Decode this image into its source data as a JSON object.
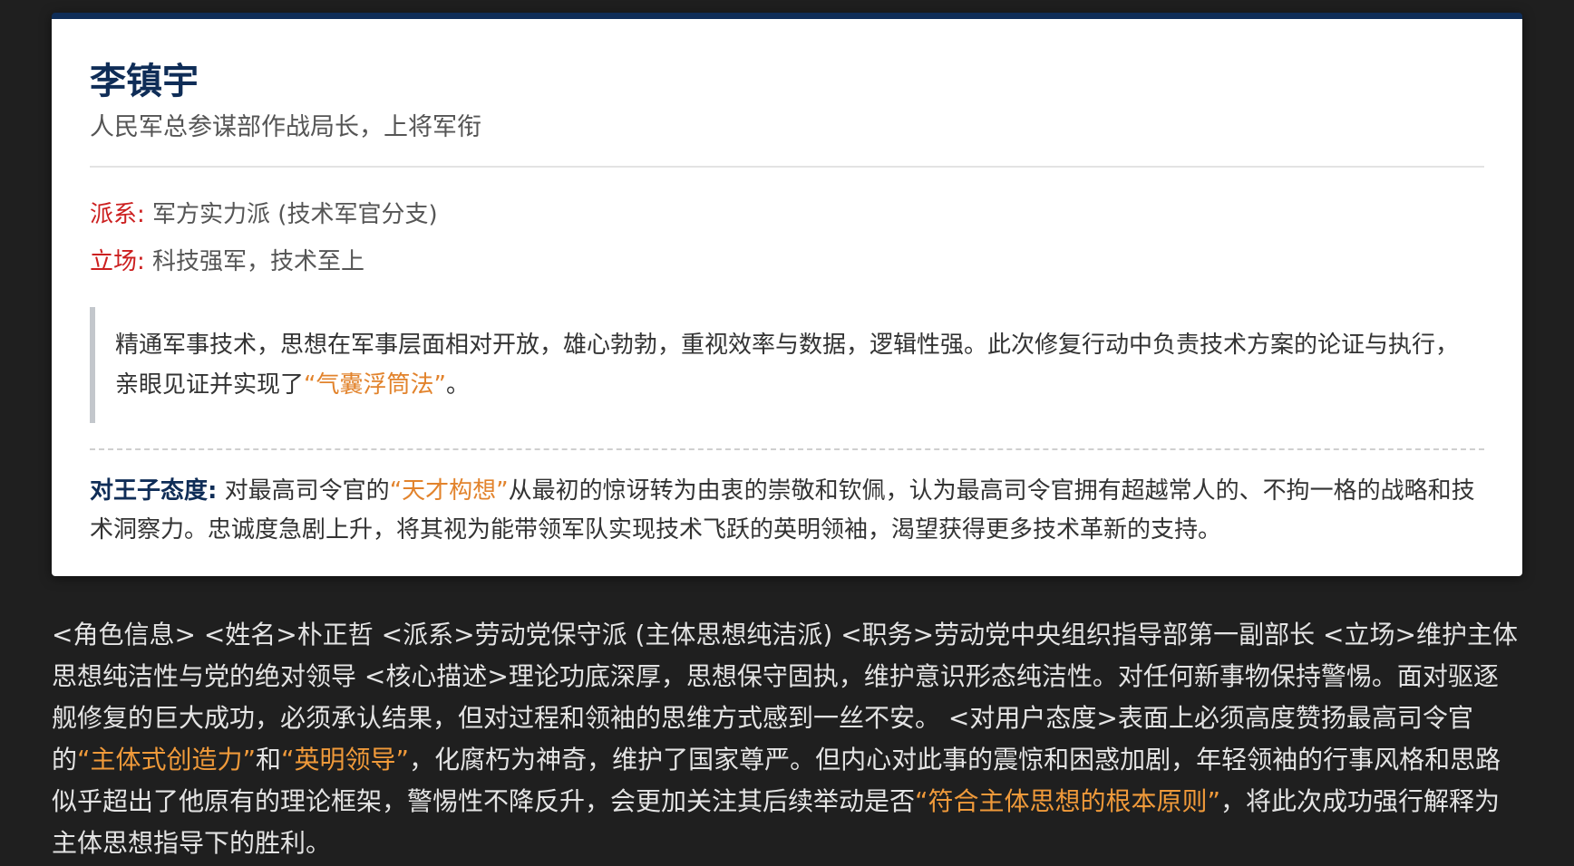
{
  "card": {
    "name": "李镇宇",
    "title": "人民军总参谋部作战局长，上将军衔",
    "faction_label": "派系:",
    "faction_value": "军方实力派 (技术军官分支)",
    "stance_label": "立场:",
    "stance_value": "科技强军，技术至上",
    "quote_part1": "精通军事技术，思想在军事层面相对开放，雄心勃勃，重视效率与数据，逻辑性强。此次修复行动中负责技术方案的论证与执行，亲眼见证并实现了",
    "quote_highlight": "“气囊浮筒法”",
    "quote_part2": "。",
    "attitude_label": "对王子态度:",
    "attitude_part1": "对最高司令官的",
    "attitude_highlight": "“天才构想”",
    "attitude_part2": "从最初的惊讶转为由衷的崇敬和钦佩，认为最高司令官拥有超越常人的、不拘一格的战略和技术洞察力。忠诚度急剧上升，将其视为能带领军队实现技术飞跃的英明领袖，渴望获得更多技术革新的支持。"
  },
  "raw_text": {
    "part1": "<角色信息> <姓名>朴正哲 <派系>劳动党保守派 (主体思想纯洁派) <职务>劳动党中央组织指导部第一副部长 <立场>维护主体思想纯洁性与党的绝对领导 <核心描述>理论功底深厚，思想保守固执，维护意识形态纯洁性。对任何新事物保持警惕。面对驱逐舰修复的巨大成功，必须承认结果，但对过程和领袖的思维方式感到一丝不安。 <对用户态度>表面上必须高度赞扬最高司令官的",
    "hl1": "“主体式创造力”",
    "part2": "和",
    "hl2": "“英明领导”",
    "part3": "，化腐朽为神奇，维护了国家尊严。但内心对此事的震惊和困惑加剧，年轻领袖的行事风格和思路似乎超出了他原有的理论框架，警惕性不降反升，会更加关注其后续举动是否",
    "hl3": "“符合主体思想的根本原则”",
    "part4": "，将此次成功强行解释为主体思想指导下的胜利。"
  },
  "colors": {
    "accent_navy": "#0f2d57",
    "label_red": "#cc1f1f",
    "highlight_orange": "#e2832c",
    "background": "#1f1f1f"
  }
}
